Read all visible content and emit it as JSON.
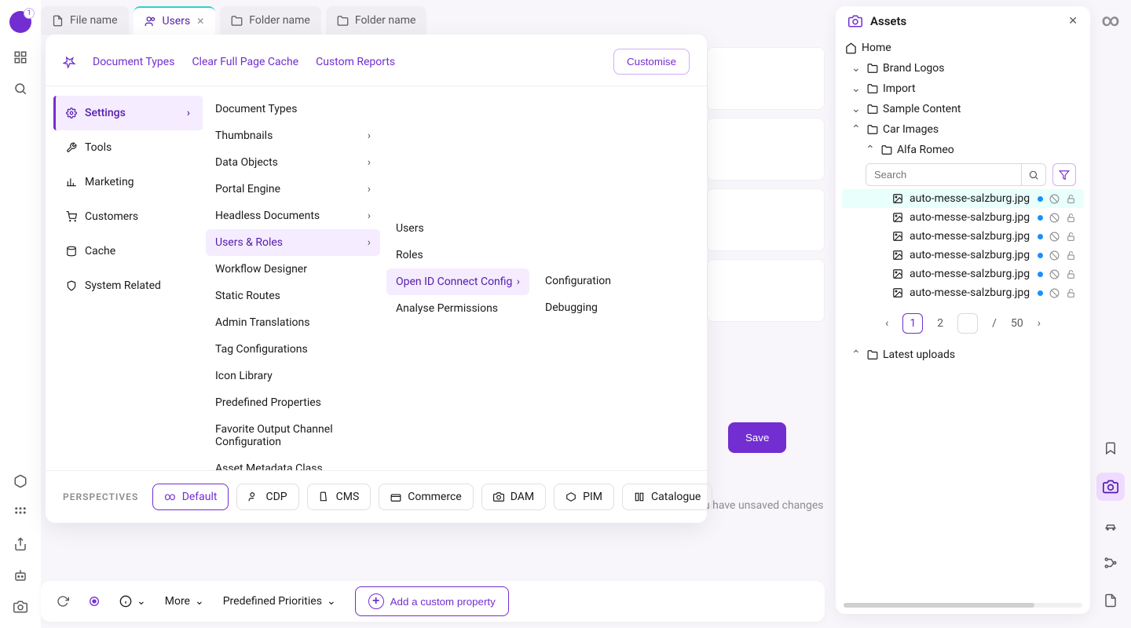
{
  "avatar_badge": "1",
  "tabs": [
    {
      "label": "File name",
      "icon": "file"
    },
    {
      "label": "Users",
      "icon": "users",
      "active": true,
      "closable": true
    },
    {
      "label": "Folder name",
      "icon": "folder"
    },
    {
      "label": "Folder name",
      "icon": "folder"
    }
  ],
  "mega": {
    "header_links": [
      "Document Types",
      "Clear Full Page Cache",
      "Custom Reports"
    ],
    "customise": "Customise",
    "col1": [
      {
        "label": "Settings",
        "active": true,
        "arrow": true,
        "icon": "gear"
      },
      {
        "label": "Tools",
        "icon": "wrench"
      },
      {
        "label": "Marketing",
        "icon": "chart"
      },
      {
        "label": "Customers",
        "icon": "cart"
      },
      {
        "label": "Cache",
        "icon": "db"
      },
      {
        "label": "System Related",
        "icon": "shield"
      }
    ],
    "col2": [
      {
        "label": "Document Types"
      },
      {
        "label": "Thumbnails",
        "arrow": true
      },
      {
        "label": "Data Objects",
        "arrow": true
      },
      {
        "label": "Portal Engine",
        "arrow": true
      },
      {
        "label": "Headless Documents",
        "arrow": true
      },
      {
        "label": "Users & Roles",
        "arrow": true,
        "active": true
      },
      {
        "label": "Workflow Designer"
      },
      {
        "label": "Static Routes"
      },
      {
        "label": "Admin Translations"
      },
      {
        "label": "Tag Configurations"
      },
      {
        "label": "Icon Library"
      },
      {
        "label": "Predefined Properties"
      },
      {
        "label": "Favorite Output Channel Configuration"
      },
      {
        "label": "Asset Metadata Class Definitions"
      }
    ],
    "col3": [
      {
        "label": "Users"
      },
      {
        "label": "Roles"
      },
      {
        "label": "Open ID Connect Config",
        "arrow": true,
        "active": true
      },
      {
        "label": "Analyse Permissions"
      }
    ],
    "col4": [
      {
        "label": "Configuration"
      },
      {
        "label": "Debugging"
      }
    ],
    "perspectives_label": "PERSPECTIVES",
    "perspectives": [
      {
        "label": "Default",
        "active": true
      },
      {
        "label": "CDP"
      },
      {
        "label": "CMS"
      },
      {
        "label": "Commerce"
      },
      {
        "label": "DAM"
      },
      {
        "label": "PIM"
      },
      {
        "label": "Catalogue"
      }
    ]
  },
  "save_label": "Save",
  "unsaved_msg": "You have unsaved changes",
  "assets": {
    "title": "Assets",
    "tree": {
      "home": "Home",
      "brand_logos": "Brand Logos",
      "import": "Import",
      "sample_content": "Sample Content",
      "car_images": "Car Images",
      "alfa_romeo": "Alfa Romeo",
      "latest_uploads": "Latest uploads"
    },
    "search_placeholder": "Search",
    "items": [
      {
        "name": "auto-messe-salzburg.jpg",
        "selected": true
      },
      {
        "name": "auto-messe-salzburg.jpg"
      },
      {
        "name": "auto-messe-salzburg.jpg"
      },
      {
        "name": "auto-messe-salzburg.jpg"
      },
      {
        "name": "auto-messe-salzburg.jpg"
      },
      {
        "name": "auto-messe-salzburg.jpg"
      }
    ],
    "page_current": "1",
    "page_two": "2",
    "page_sep": "/",
    "page_total": "50"
  },
  "bottom": {
    "more": "More",
    "priorities": "Predefined Priorities",
    "add_custom": "Add a custom property"
  }
}
